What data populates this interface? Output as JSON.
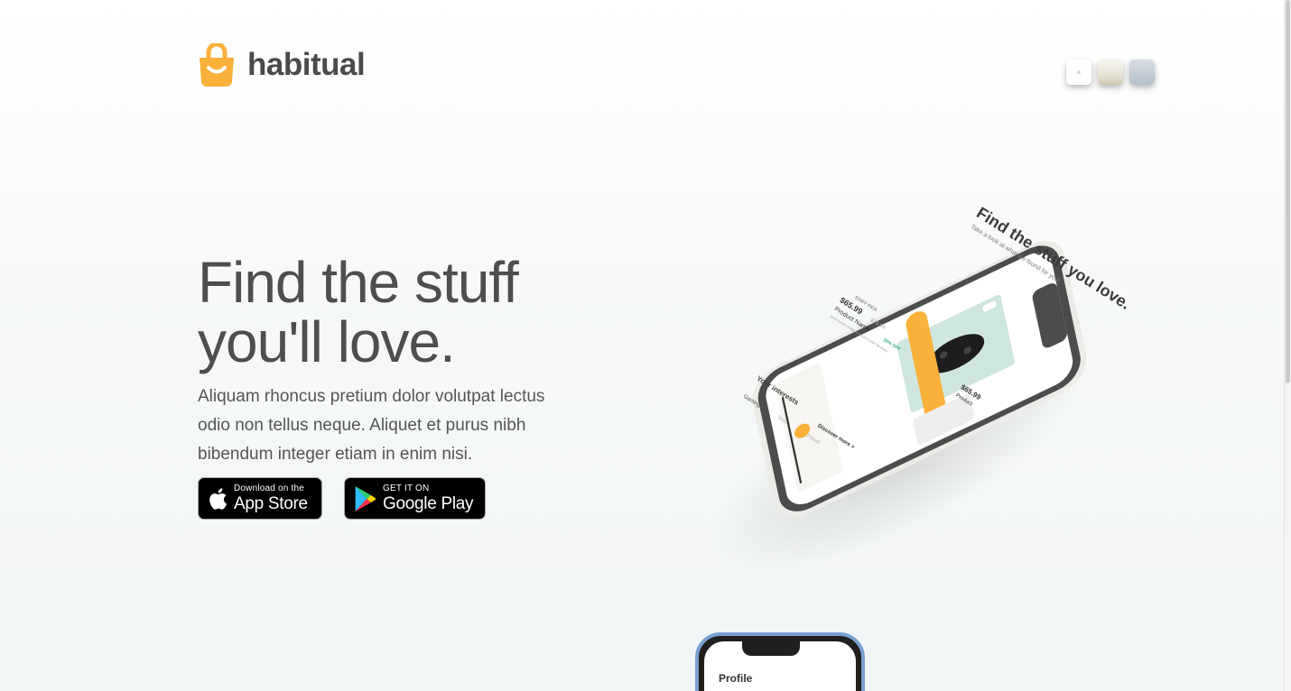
{
  "brand": {
    "name": "habitual",
    "accent": "#f9b13a"
  },
  "theme_swatches": [
    {
      "name": "white",
      "color": "#ffffff"
    },
    {
      "name": "sand",
      "color": "#e8e4d6"
    },
    {
      "name": "slate",
      "color": "#b5c0cb"
    }
  ],
  "hero": {
    "title_line1": "Find the stuff",
    "title_line2": "you'll love.",
    "description": "Aliquam rhoncus pretium dolor volutpat lectus odio non tellus neque. Aliquet et purus nibh bibendum integer etiam in enim nisi."
  },
  "store_buttons": {
    "appstore": {
      "small": "Download on the",
      "big": "App Store"
    },
    "googleplay": {
      "small": "GET IT ON",
      "big": "Google Play"
    }
  },
  "phone_screen": {
    "heading": "Find the stuff you love.",
    "subheading": "Take a look at what we found for you!",
    "badge": "STAFF PICK",
    "price": "$65.99",
    "old_price": "$79.99",
    "discount": "20% OFF",
    "product_name": "Product Name",
    "product_desc": "Amet lorem mollis id Ipsum Dolor Sit Amet",
    "cta": "Discover more",
    "price2": "$65.99",
    "product2": "Product",
    "interests_title": "Your interests",
    "interests": [
      "Gaming",
      "Tech",
      "Travel"
    ],
    "discover_link": "Discover more >"
  },
  "second_phone": {
    "title": "Profile"
  }
}
